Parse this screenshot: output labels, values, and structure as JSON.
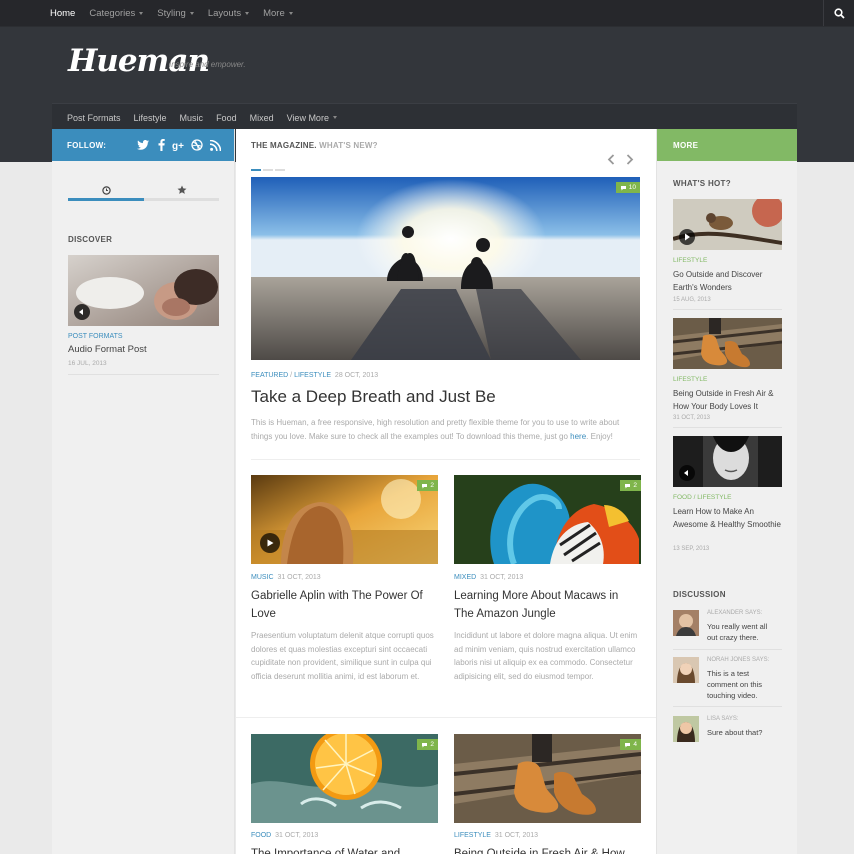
{
  "topnav": {
    "items": [
      {
        "label": "Home",
        "active": true,
        "dropdown": false
      },
      {
        "label": "Categories",
        "active": false,
        "dropdown": true
      },
      {
        "label": "Styling",
        "active": false,
        "dropdown": true
      },
      {
        "label": "Layouts",
        "active": false,
        "dropdown": true
      },
      {
        "label": "More",
        "active": false,
        "dropdown": true
      }
    ],
    "search_icon": "search-icon"
  },
  "header": {
    "logo": "Hueman",
    "tagline": "Inspire and empower."
  },
  "subnav": {
    "items": [
      "Post Formats",
      "Lifestyle",
      "Music",
      "Food",
      "Mixed",
      "View More"
    ]
  },
  "left_sidebar": {
    "follow_label": "FOLLOW:",
    "social_icons": [
      "twitter-icon",
      "facebook-icon",
      "google-plus-icon",
      "dribbble-icon",
      "rss-icon"
    ],
    "tabs": [
      "clock-icon",
      "star-icon"
    ],
    "discover_heading": "DISCOVER",
    "discover_post": {
      "category": "POST FORMATS",
      "title": "Audio Format Post",
      "date": "16 JUL, 2013"
    }
  },
  "main": {
    "header_bold": "THE MAGAZINE.",
    "header_muted": "WHAT'S NEW?",
    "featured": {
      "cat1": "FEATURED",
      "cat2": "LIFESTYLE",
      "date": "28 OCT, 2013",
      "comments": "10",
      "title": "Take a Deep Breath and Just Be",
      "excerpt_start": "This is Hueman, a free responsive, high resolution and pretty flexible theme for you to use to write about things you love. Make sure to check all the examples out! To download this theme, just go ",
      "excerpt_link": "here",
      "excerpt_end": ". Enjoy!"
    },
    "posts": [
      {
        "category": "MUSIC",
        "date": "31 OCT, 2013",
        "comments": "2",
        "title": "Gabrielle Aplin with The Power Of Love",
        "excerpt": "Praesentium voluptatum delenit atque corrupti quos dolores et quas molestias excepturi sint occaecati cupiditate non provident, similique sunt in culpa qui officia deserunt mollitia animi, id est laborum et."
      },
      {
        "category": "MIXED",
        "date": "31 OCT, 2013",
        "comments": "2",
        "title": "Learning More About Macaws in The Amazon Jungle",
        "excerpt": "Incididunt ut labore et dolore magna aliqua. Ut enim ad minim veniam, quis nostrud exercitation ullamco laboris nisi ut aliquip ex ea commodo. Consectetur adipisicing elit, sed do eiusmod tempor."
      },
      {
        "category": "FOOD",
        "date": "31 OCT, 2013",
        "comments": "2",
        "title": "The Importance of Water and"
      },
      {
        "category": "LIFESTYLE",
        "date": "31 OCT, 2013",
        "comments": "4",
        "title": "Being Outside in Fresh Air & How"
      }
    ]
  },
  "right_sidebar": {
    "more_label": "MORE",
    "hot_heading": "WHAT'S HOT?",
    "hot_posts": [
      {
        "category": "LIFESTYLE",
        "title": "Go Outside and Discover Earth's Wonders",
        "date": "15 AUG, 2013"
      },
      {
        "category": "LIFESTYLE",
        "title": "Being Outside in Fresh Air & How Your Body Loves It",
        "date": "31 OCT, 2013"
      },
      {
        "category": "FOOD / LIFESTYLE",
        "title": "Learn How to Make An Awesome & Healthy Smoothie",
        "date": "13 SEP, 2013"
      }
    ],
    "discussion_heading": "DISCUSSION",
    "comments": [
      {
        "author": "ALEXANDER SAYS:",
        "text": "You really went all out crazy there."
      },
      {
        "author": "NORAH JONES SAYS:",
        "text": "This is a test comment on this touching video."
      },
      {
        "author": "LISA SAYS:",
        "text": "Sure about that?"
      }
    ]
  },
  "colors": {
    "accent_blue": "#3b8dbd",
    "accent_green": "#82b965",
    "header_bg": "#33363b",
    "topbar_bg": "#26272b"
  }
}
